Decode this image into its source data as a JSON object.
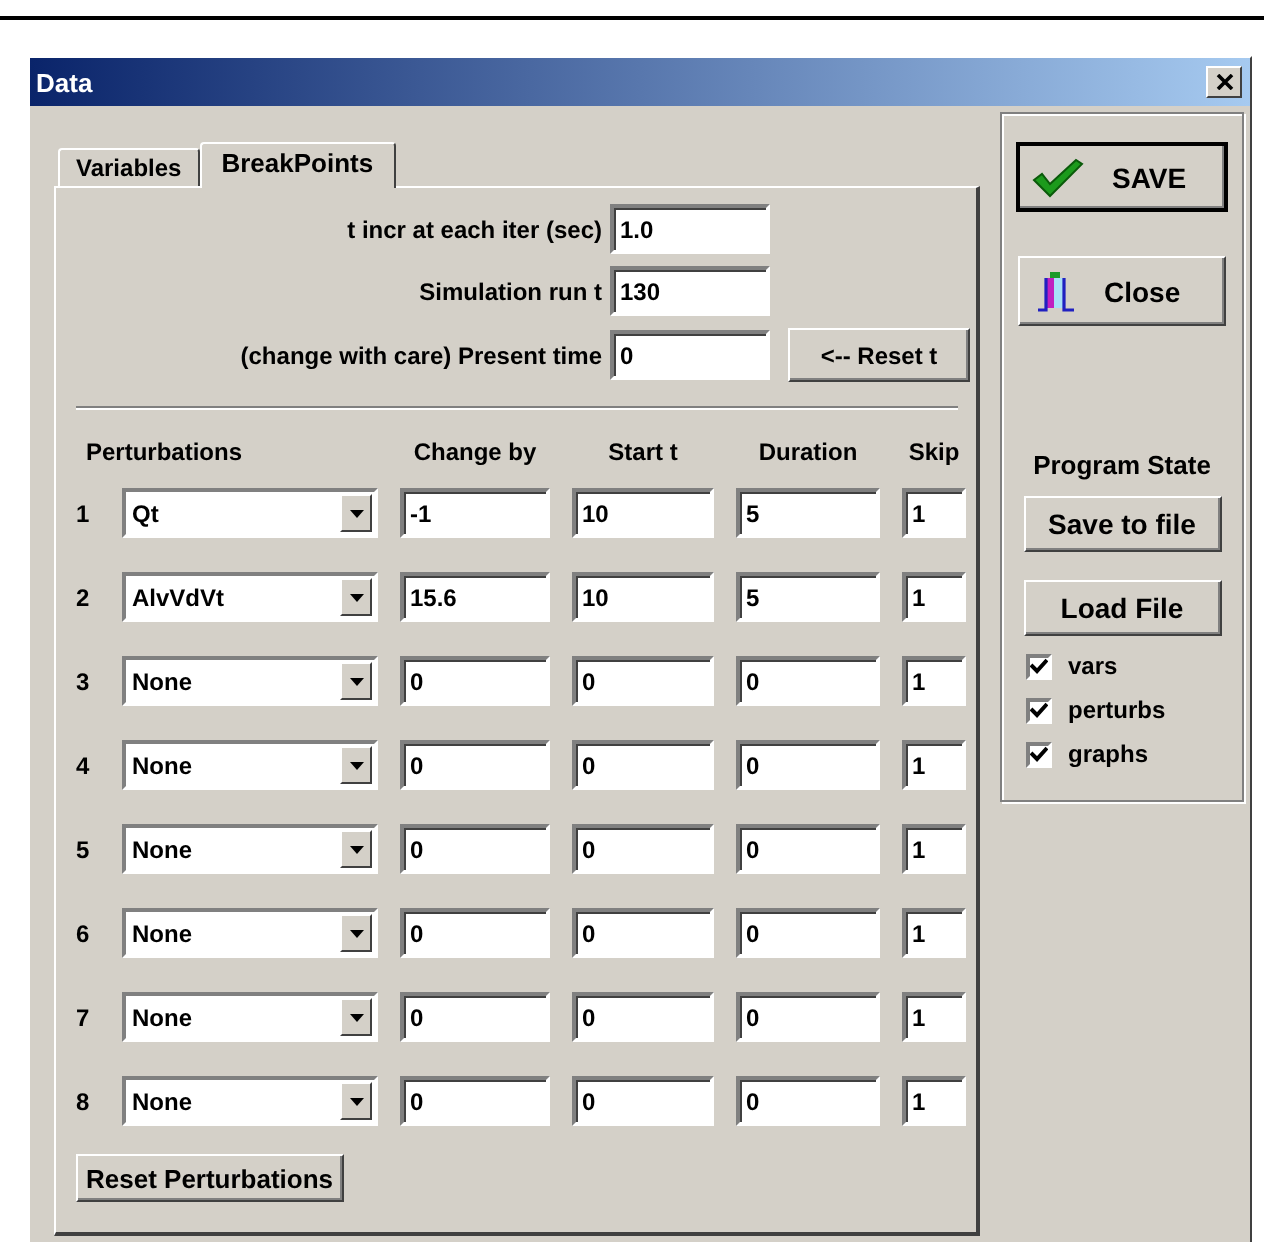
{
  "window": {
    "title": "Data"
  },
  "tabs": [
    {
      "label": "Variables",
      "selected": false
    },
    {
      "label": "BreakPoints",
      "selected": true
    }
  ],
  "settings": [
    {
      "label": "t incr at each iter (sec)",
      "value": "1.0"
    },
    {
      "label": "Simulation run t",
      "value": "130"
    },
    {
      "label": "(change with care) Present time",
      "value": "0",
      "button": "<-- Reset t"
    }
  ],
  "columns": [
    "Perturbations",
    "Change by",
    "Start t",
    "Duration",
    "Skip"
  ],
  "rows": [
    {
      "number": "1",
      "perturbation": "Qt",
      "change_by": "-1",
      "start_t": "10",
      "duration": "5",
      "skip": "1"
    },
    {
      "number": "2",
      "perturbation": "AlvVdVt",
      "change_by": "15.6",
      "start_t": "10",
      "duration": "5",
      "skip": "1"
    },
    {
      "number": "3",
      "perturbation": "None",
      "change_by": "0",
      "start_t": "0",
      "duration": "0",
      "skip": "1"
    },
    {
      "number": "4",
      "perturbation": "None",
      "change_by": "0",
      "start_t": "0",
      "duration": "0",
      "skip": "1"
    },
    {
      "number": "5",
      "perturbation": "None",
      "change_by": "0",
      "start_t": "0",
      "duration": "0",
      "skip": "1"
    },
    {
      "number": "6",
      "perturbation": "None",
      "change_by": "0",
      "start_t": "0",
      "duration": "0",
      "skip": "1"
    },
    {
      "number": "7",
      "perturbation": "None",
      "change_by": "0",
      "start_t": "0",
      "duration": "0",
      "skip": "1"
    },
    {
      "number": "8",
      "perturbation": "None",
      "change_by": "0",
      "start_t": "0",
      "duration": "0",
      "skip": "1"
    }
  ],
  "reset_perturbations_button": "Reset Perturbations",
  "sidebar": {
    "save_button": "SAVE",
    "close_button": "Close",
    "program_state_label": "Program State",
    "save_to_file_button": "Save to file",
    "load_file_button": "Load File",
    "options": [
      {
        "label": "vars",
        "checked": true
      },
      {
        "label": "perturbs",
        "checked": true
      },
      {
        "label": "graphs",
        "checked": true
      }
    ]
  }
}
